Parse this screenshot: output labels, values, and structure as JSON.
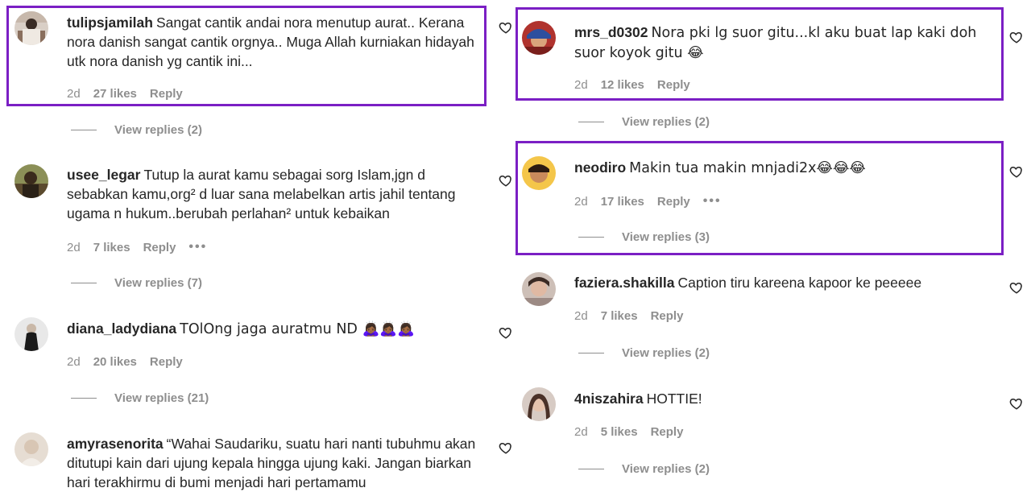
{
  "colors": {
    "highlight": "#7b1fc4",
    "muted": "#8e8e8e",
    "text": "#262626"
  },
  "left": [
    {
      "username": "tulipsjamilah",
      "text": "Sangat cantik andai nora menutup aurat.. Kerana nora danish sangat cantik orgnya.. Muga Allah kurniakan hidayah utk nora danish yg cantik ini...",
      "time": "2d",
      "likes": "27 likes",
      "reply": "Reply",
      "view_replies": "View replies (2)"
    },
    {
      "username": "usee_legar",
      "text": "Tutup la aurat kamu sebagai sorg Islam,jgn d sebabkan kamu,org² d luar sana melabelkan artis jahil tentang ugama n hukum..berubah perlahan² untuk kebaikan",
      "time": "2d",
      "likes": "7 likes",
      "reply": "Reply",
      "more": "•••",
      "view_replies": "View replies (7)"
    },
    {
      "username": "diana_ladydiana",
      "text": "TOlOng jaga auratmu ND 🙇🏾‍♀️🙇🏾‍♀️🙇🏾‍♀️",
      "time": "2d",
      "likes": "20 likes",
      "reply": "Reply",
      "view_replies": "View replies (21)"
    },
    {
      "username": "amyrasenorita",
      "text": "“Wahai Saudariku, suatu hari nanti tubuhmu akan ditutupi kain dari ujung kepala hingga ujung kaki. Jangan biarkan hari terakhirmu di bumi menjadi hari pertamamu"
    }
  ],
  "right": [
    {
      "username": "mrs_d0302",
      "text": "Nora pki lg suor gitu...kl aku buat lap kaki doh suor koyok gitu 😂",
      "time": "2d",
      "likes": "12 likes",
      "reply": "Reply",
      "view_replies": "View replies (2)"
    },
    {
      "username": "neodiro",
      "text": "Makin tua makin mnjadi2x😂😂😂",
      "time": "2d",
      "likes": "17 likes",
      "reply": "Reply",
      "more": "•••",
      "view_replies": "View replies (3)"
    },
    {
      "username": "faziera.shakilla",
      "text": "Caption tiru kareena kapoor ke peeeee",
      "time": "2d",
      "likes": "7 likes",
      "reply": "Reply",
      "view_replies": "View replies (2)"
    },
    {
      "username": "4niszahira",
      "text": "HOTTIE!",
      "time": "2d",
      "likes": "5 likes",
      "reply": "Reply",
      "view_replies": "View replies (2)"
    }
  ]
}
